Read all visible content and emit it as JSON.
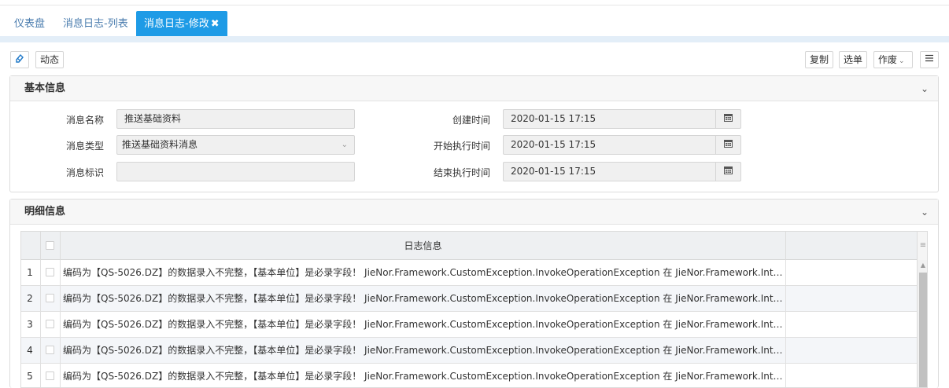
{
  "tabs": [
    {
      "label": "仪表盘"
    },
    {
      "label": "消息日志-列表"
    },
    {
      "label": "消息日志-修改"
    }
  ],
  "toolbar": {
    "dynamic_label": "动态",
    "copy_label": "复制",
    "select_label": "选单",
    "void_label": "作废"
  },
  "basic": {
    "title": "基本信息",
    "fields": {
      "name_label": "消息名称",
      "name_value": "推送基础资料",
      "type_label": "消息类型",
      "type_value": "推送基础资料消息",
      "tag_label": "消息标识",
      "tag_value": "",
      "created_label": "创建时间",
      "created_value": "2020-01-15 17:15",
      "start_label": "开始执行时间",
      "start_value": "2020-01-15 17:15",
      "end_label": "结束执行时间",
      "end_value": "2020-01-15 17:15"
    }
  },
  "detail": {
    "title": "明细信息",
    "column_header": "日志信息",
    "rows": [
      {
        "num": "1",
        "msg": "编码为【QS-5026.DZ】的数据录入不完整，【基本单位】是必录字段！ JieNor.Framework.CustomException.InvokeOperationException 在 JieNor.Framework.Interf..."
      },
      {
        "num": "2",
        "msg": "编码为【QS-5026.DZ】的数据录入不完整，【基本单位】是必录字段！ JieNor.Framework.CustomException.InvokeOperationException 在 JieNor.Framework.Interf..."
      },
      {
        "num": "3",
        "msg": "编码为【QS-5026.DZ】的数据录入不完整，【基本单位】是必录字段！ JieNor.Framework.CustomException.InvokeOperationException 在 JieNor.Framework.Interf..."
      },
      {
        "num": "4",
        "msg": "编码为【QS-5026.DZ】的数据录入不完整，【基本单位】是必录字段！ JieNor.Framework.CustomException.InvokeOperationException 在 JieNor.Framework.Interf..."
      },
      {
        "num": "5",
        "msg": "编码为【QS-5026.DZ】的数据录入不完整，【基本单位】是必录字段！ JieNor.Framework.CustomException.InvokeOperationException 在 JieNor.Framework.Interf..."
      }
    ]
  },
  "colors": {
    "accent": "#1e9be6",
    "tab_text": "#4a7cae"
  }
}
